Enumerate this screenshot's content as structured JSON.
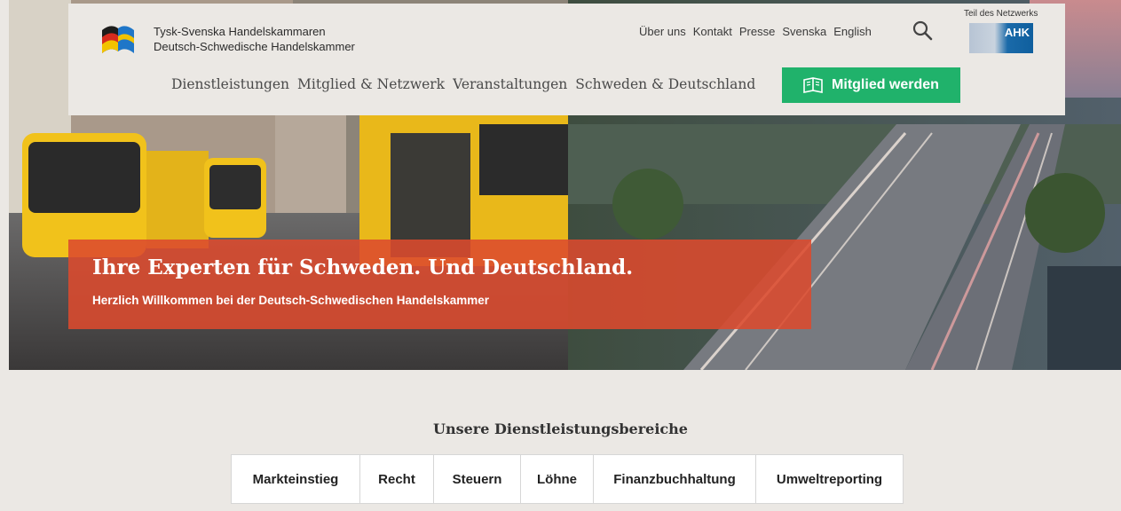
{
  "brand": {
    "line1": "Tysk-Svenska Handelskammaren",
    "line2": "Deutsch-Schwedische Handelskammer"
  },
  "topnav": [
    "Über uns",
    "Kontakt",
    "Presse",
    "Svenska",
    "English"
  ],
  "network": {
    "label": "Teil des Netzwerks",
    "badge": "AHK"
  },
  "mainnav": [
    "Dienstleistungen",
    "Mitglied & Netzwerk",
    "Veranstaltungen",
    "Schweden & Deutschland"
  ],
  "cta": {
    "label": "Mitglied werden",
    "color": "#20b26b"
  },
  "banner": {
    "title": "Ihre Experten für Schweden. Und Deutschland.",
    "subtitle": "Herzlich Willkommen bei der Deutsch-Schwedischen Handelskammer",
    "color": "#dc4a2e"
  },
  "services": {
    "title": "Unsere Dienstleistungsbereiche",
    "tabs": [
      "Markteinstieg",
      "Recht",
      "Steuern",
      "Löhne",
      "Finanzbuchhaltung",
      "Umweltreporting"
    ]
  }
}
